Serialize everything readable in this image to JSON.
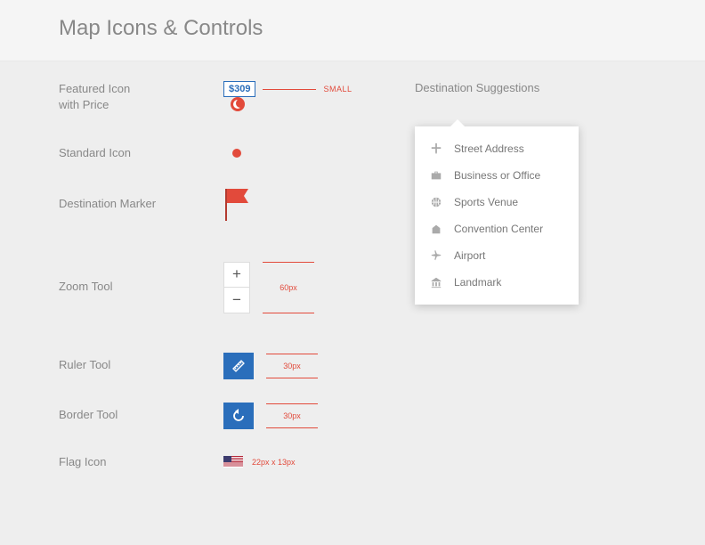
{
  "header": {
    "title": "Map Icons & Controls"
  },
  "rows": {
    "featured": {
      "label": "Featured Icon\nwith Price",
      "price": "$309",
      "annot": "SMALL"
    },
    "standard": {
      "label": "Standard Icon"
    },
    "destination": {
      "label": "Destination Marker"
    },
    "zoom": {
      "label": "Zoom Tool",
      "dim": "60px"
    },
    "ruler": {
      "label": "Ruler Tool",
      "dim": "30px"
    },
    "border": {
      "label": "Border Tool",
      "dim": "30px"
    },
    "flag": {
      "label": "Flag Icon",
      "dim": "22px x 13px"
    }
  },
  "right": {
    "title": "Destination Suggestions",
    "items": [
      {
        "label": "Street Address"
      },
      {
        "label": "Business or Office"
      },
      {
        "label": "Sports Venue"
      },
      {
        "label": "Convention Center"
      },
      {
        "label": "Airport"
      },
      {
        "label": "Landmark"
      }
    ]
  }
}
